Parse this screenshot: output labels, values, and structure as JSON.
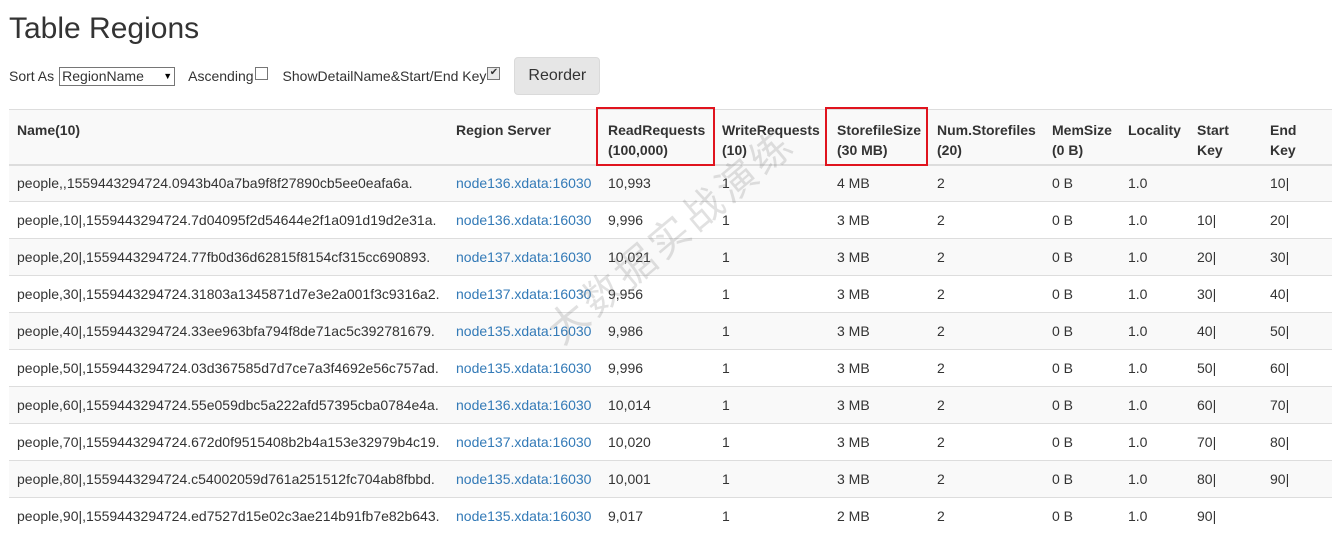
{
  "page": {
    "title": "Table Regions"
  },
  "controls": {
    "sort_label": "Sort As",
    "sort_value": "RegionName",
    "ascending_label": "Ascending",
    "ascending_checked": false,
    "show_detail_label": "ShowDetailName&Start/End Key",
    "show_detail_checked": true,
    "reorder_label": "Reorder"
  },
  "table": {
    "headers": {
      "name": "Name(10)",
      "region_server": "Region Server",
      "read_requests": "ReadRequests",
      "read_requests_total": "(100,000)",
      "write_requests": "WriteRequests",
      "write_requests_total": "(10)",
      "storefile_size": "StorefileSize",
      "storefile_size_total": "(30 MB)",
      "num_storefiles": "Num.Storefiles",
      "num_storefiles_total": "(20)",
      "mem_size": "MemSize",
      "mem_size_total": "(0 B)",
      "locality": "Locality",
      "start_key": "Start",
      "start_key_2": "Key",
      "end_key": "End",
      "end_key_2": "Key"
    },
    "rows": [
      {
        "name": "people,,1559443294724.0943b40a7ba9f8f27890cb5ee0eafa6a.",
        "server": "node136.xdata:16030",
        "read": "10,993",
        "write": "1",
        "storefile": "4 MB",
        "num": "2",
        "mem": "0 B",
        "locality": "1.0",
        "start": "",
        "end": "10|"
      },
      {
        "name": "people,10|,1559443294724.7d04095f2d54644e2f1a091d19d2e31a.",
        "server": "node136.xdata:16030",
        "read": "9,996",
        "write": "1",
        "storefile": "3 MB",
        "num": "2",
        "mem": "0 B",
        "locality": "1.0",
        "start": "10|",
        "end": "20|"
      },
      {
        "name": "people,20|,1559443294724.77fb0d36d62815f8154cf315cc690893.",
        "server": "node137.xdata:16030",
        "read": "10,021",
        "write": "1",
        "storefile": "3 MB",
        "num": "2",
        "mem": "0 B",
        "locality": "1.0",
        "start": "20|",
        "end": "30|"
      },
      {
        "name": "people,30|,1559443294724.31803a1345871d7e3e2a001f3c9316a2.",
        "server": "node137.xdata:16030",
        "read": "9,956",
        "write": "1",
        "storefile": "3 MB",
        "num": "2",
        "mem": "0 B",
        "locality": "1.0",
        "start": "30|",
        "end": "40|"
      },
      {
        "name": "people,40|,1559443294724.33ee963bfa794f8de71ac5c392781679.",
        "server": "node135.xdata:16030",
        "read": "9,986",
        "write": "1",
        "storefile": "3 MB",
        "num": "2",
        "mem": "0 B",
        "locality": "1.0",
        "start": "40|",
        "end": "50|"
      },
      {
        "name": "people,50|,1559443294724.03d367585d7d7ce7a3f4692e56c757ad.",
        "server": "node135.xdata:16030",
        "read": "9,996",
        "write": "1",
        "storefile": "3 MB",
        "num": "2",
        "mem": "0 B",
        "locality": "1.0",
        "start": "50|",
        "end": "60|"
      },
      {
        "name": "people,60|,1559443294724.55e059dbc5a222afd57395cba0784e4a.",
        "server": "node136.xdata:16030",
        "read": "10,014",
        "write": "1",
        "storefile": "3 MB",
        "num": "2",
        "mem": "0 B",
        "locality": "1.0",
        "start": "60|",
        "end": "70|"
      },
      {
        "name": "people,70|,1559443294724.672d0f9515408b2b4a153e32979b4c19.",
        "server": "node137.xdata:16030",
        "read": "10,020",
        "write": "1",
        "storefile": "3 MB",
        "num": "2",
        "mem": "0 B",
        "locality": "1.0",
        "start": "70|",
        "end": "80|"
      },
      {
        "name": "people,80|,1559443294724.c54002059d761a251512fc704ab8fbbd.",
        "server": "node135.xdata:16030",
        "read": "10,001",
        "write": "1",
        "storefile": "3 MB",
        "num": "2",
        "mem": "0 B",
        "locality": "1.0",
        "start": "80|",
        "end": "90|"
      },
      {
        "name": "people,90|,1559443294724.ed7527d15e02c3ae214b91fb7e82b643.",
        "server": "node135.xdata:16030",
        "read": "9,017",
        "write": "1",
        "storefile": "2 MB",
        "num": "2",
        "mem": "0 B",
        "locality": "1.0",
        "start": "90|",
        "end": ""
      }
    ]
  },
  "watermark": "大数据实战演练",
  "colors": {
    "link": "#337ab7",
    "highlight_box": "#e0141e"
  }
}
